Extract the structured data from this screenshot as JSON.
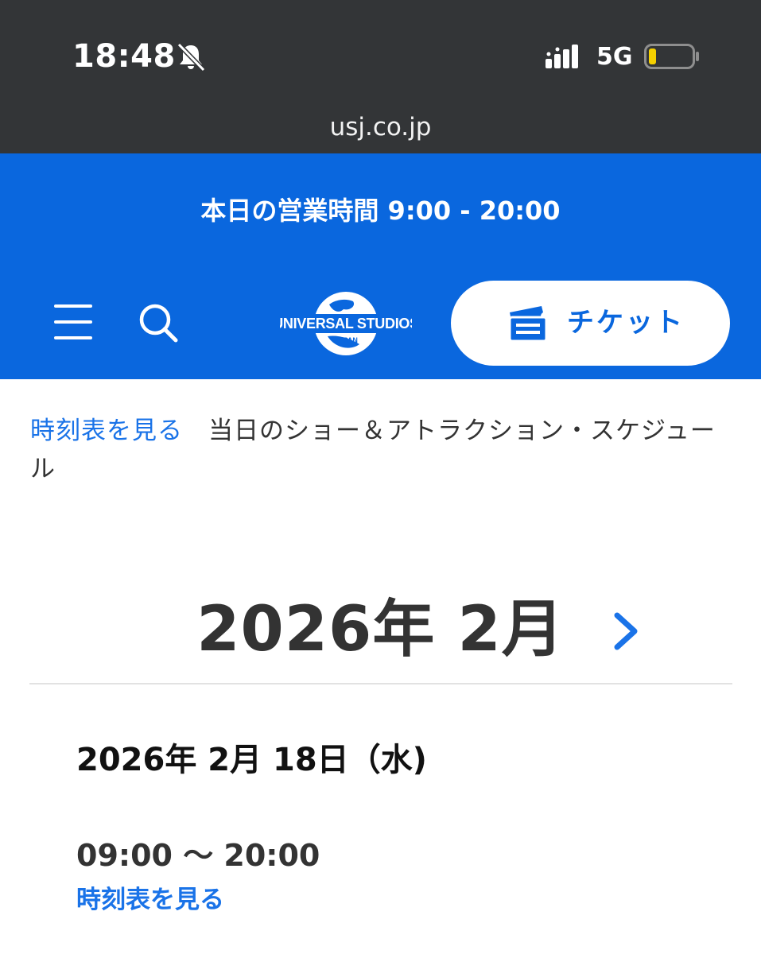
{
  "status_bar": {
    "time": "18:48",
    "network": "5G",
    "icons": [
      "bell-slash-icon",
      "signal-icon",
      "battery-icon"
    ]
  },
  "browser": {
    "url": "usj.co.jp"
  },
  "header": {
    "hours_banner": "本日の営業時間 9:00 - 20:00",
    "logo_text": "UNIVERSAL STUDIOS JAPAN",
    "ticket_label": "チケット",
    "icons": [
      "menu-icon",
      "search-icon",
      "ticket-icon"
    ]
  },
  "breadcrumb": {
    "link": "時刻表を見る",
    "current": "当日のショー＆アトラクション・スケジュール"
  },
  "calendar": {
    "month_title": "2026年 2月",
    "next_icon": "chevron-right-icon"
  },
  "day": {
    "date": "2026年 2月 18日（水)",
    "hours": "09:00 〜 20:00",
    "link": "時刻表を見る"
  },
  "colors": {
    "status_bg": "#333537",
    "brand_blue": "#0a67de",
    "link_blue": "#1a73e8",
    "battery_low": "#f5d000"
  }
}
